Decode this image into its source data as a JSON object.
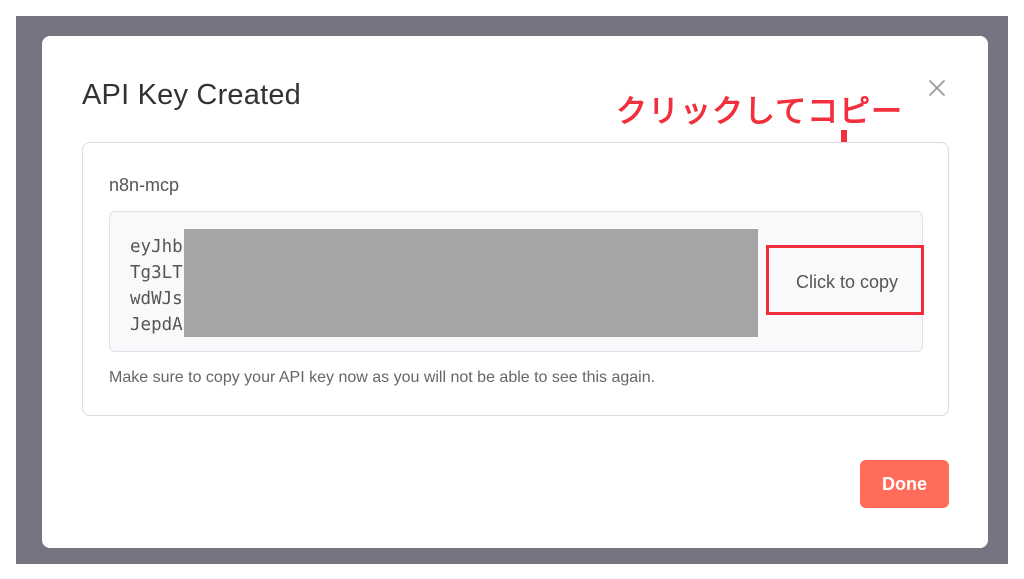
{
  "modal": {
    "title": "API Key Created",
    "close_icon": "close-icon"
  },
  "annotation": {
    "text": "クリックしてコピー",
    "color": "#f22f3c"
  },
  "card": {
    "key_name": "n8n-mcp",
    "key_lines": [
      "eyJhb",
      "Tg3LT",
      "wdWJs",
      "JepdA"
    ],
    "copy_label": "Click to copy",
    "helper_text": "Make sure to copy your API key now as you will not be able to see this again."
  },
  "footer": {
    "done_label": "Done"
  },
  "colors": {
    "overlay": "#787380",
    "accent": "#ff6d5a",
    "redaction": "#a5a5a5",
    "highlight": "#ee2f39"
  }
}
